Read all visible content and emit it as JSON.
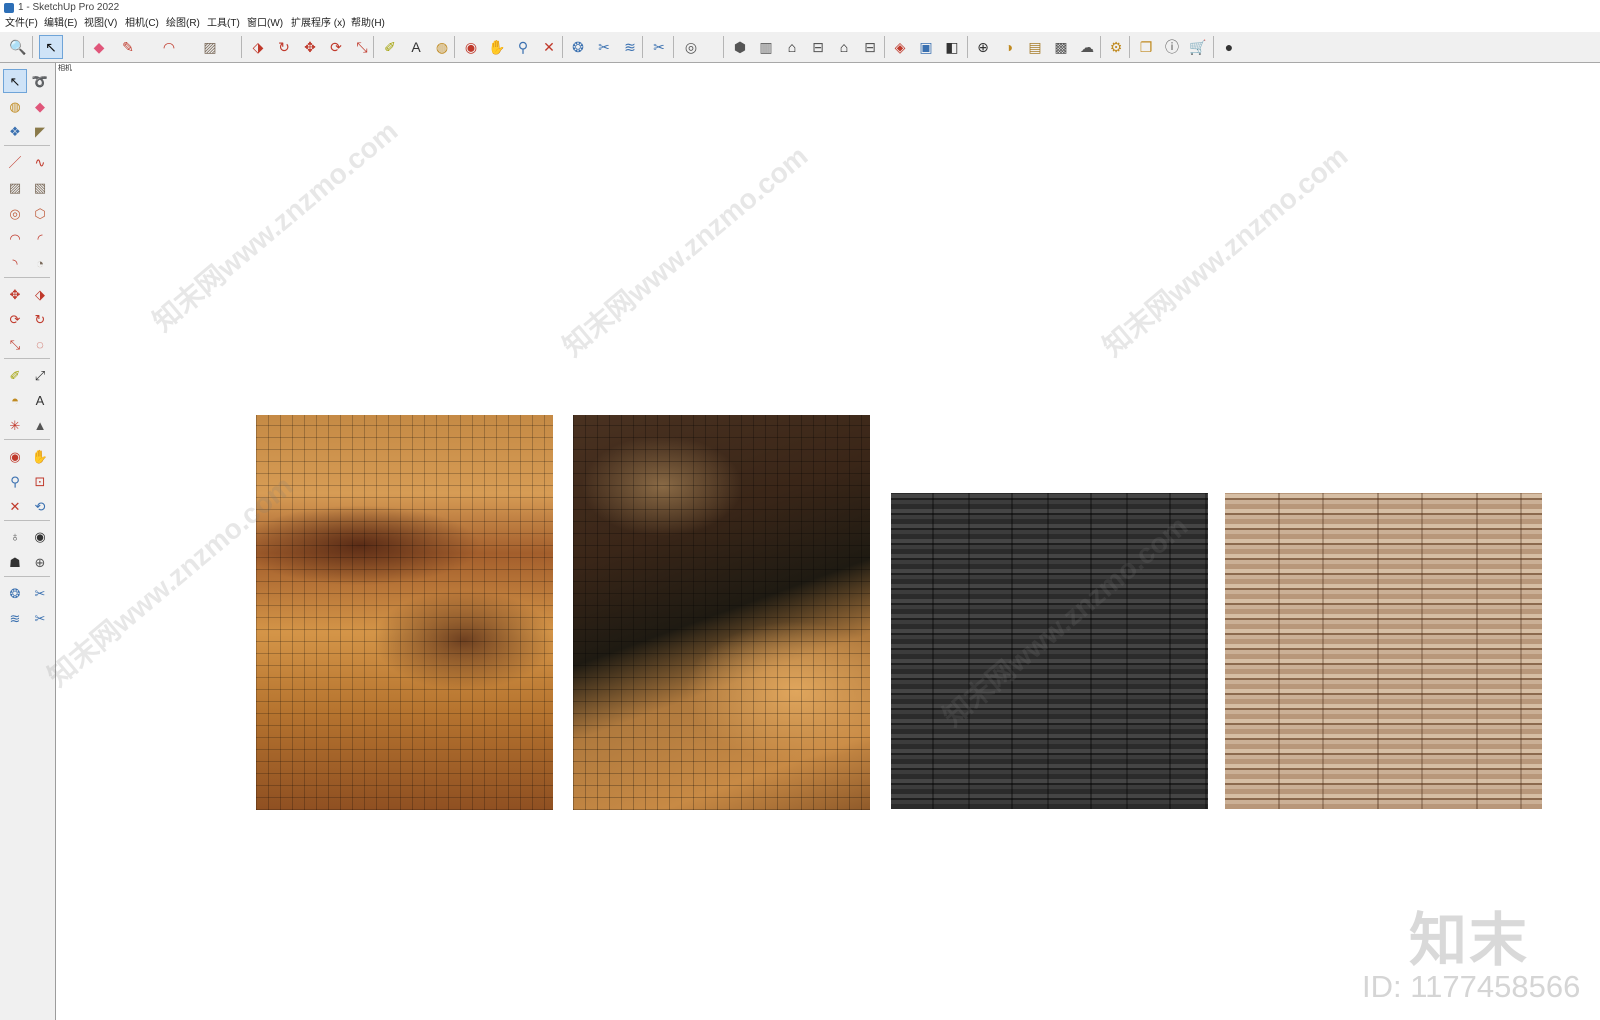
{
  "window": {
    "title": "1 - SketchUp Pro 2022"
  },
  "menu": {
    "items": [
      "文件(F)",
      "编辑(E)",
      "视图(V)",
      "相机(C)",
      "绘图(R)",
      "工具(T)",
      "窗口(W)",
      "扩展程序 (x)",
      "帮助(H)"
    ]
  },
  "toolbar": {
    "tools": [
      {
        "icon": "zoom-icon",
        "glyph": "🔍"
      },
      {
        "icon": "select-icon",
        "glyph": "↖"
      },
      {
        "icon": "eraser-icon",
        "glyph": "◆"
      },
      {
        "icon": "pencil-icon",
        "glyph": "✎"
      },
      {
        "icon": "arc-icon",
        "glyph": "◠"
      },
      {
        "icon": "rectangle-icon",
        "glyph": "▨"
      },
      {
        "icon": "push-pull-icon",
        "glyph": "⬗"
      },
      {
        "icon": "follow-me-icon",
        "glyph": "↻"
      },
      {
        "icon": "move-icon",
        "glyph": "✥"
      },
      {
        "icon": "rotate-icon",
        "glyph": "⟳"
      },
      {
        "icon": "scale-icon",
        "glyph": "⤡"
      },
      {
        "icon": "tape-measure-icon",
        "glyph": "✐"
      },
      {
        "icon": "text-icon",
        "glyph": "A"
      },
      {
        "icon": "paint-bucket-icon",
        "glyph": "◍"
      },
      {
        "icon": "orbit-icon",
        "glyph": "◉"
      },
      {
        "icon": "pan-icon",
        "glyph": "✋"
      },
      {
        "icon": "zoom-tool-icon",
        "glyph": "⚲"
      },
      {
        "icon": "zoom-extents-icon",
        "glyph": "✕"
      },
      {
        "icon": "warehouse-icon",
        "glyph": "❂"
      },
      {
        "icon": "extension-icon",
        "glyph": "✂"
      },
      {
        "icon": "layers-icon",
        "glyph": "≋"
      },
      {
        "icon": "extension-2-icon",
        "glyph": "✂"
      },
      {
        "icon": "user-icon",
        "glyph": "◎"
      },
      {
        "icon": "iso-view-icon",
        "glyph": "⬢"
      },
      {
        "icon": "top-view-icon",
        "glyph": "▥"
      },
      {
        "icon": "front-view-icon",
        "glyph": "⌂"
      },
      {
        "icon": "right-view-icon",
        "glyph": "⊟"
      },
      {
        "icon": "back-view-icon",
        "glyph": "⌂"
      },
      {
        "icon": "left-view-icon",
        "glyph": "⊟"
      },
      {
        "icon": "section-plane-icon",
        "glyph": "◈"
      },
      {
        "icon": "section-display-icon",
        "glyph": "▣"
      },
      {
        "icon": "section-cut-icon",
        "glyph": "◧"
      },
      {
        "icon": "add-location-icon",
        "glyph": "⊕"
      },
      {
        "icon": "shadows-icon",
        "glyph": "◑"
      },
      {
        "icon": "styles-icon",
        "glyph": "▤"
      },
      {
        "icon": "fog-icon",
        "glyph": "▩"
      },
      {
        "icon": "cloud-icon",
        "glyph": "☁"
      },
      {
        "icon": "extension-manager-icon",
        "glyph": "⚙"
      },
      {
        "icon": "components-icon",
        "glyph": "❐"
      },
      {
        "icon": "info-icon",
        "glyph": "ⓘ"
      },
      {
        "icon": "cart-icon",
        "glyph": "🛒"
      },
      {
        "icon": "account-icon",
        "glyph": "●"
      }
    ]
  },
  "left_toolbar": {
    "tools": [
      {
        "icon": "select-icon",
        "glyph": "↖"
      },
      {
        "icon": "lasso-icon",
        "glyph": "➰"
      },
      {
        "icon": "paint-bucket-icon",
        "glyph": "◍"
      },
      {
        "icon": "eraser-icon",
        "glyph": "◆"
      },
      {
        "icon": "component-icon",
        "glyph": "❖"
      },
      {
        "icon": "tag-icon",
        "glyph": "◤"
      },
      {
        "icon": "line-icon",
        "glyph": "／"
      },
      {
        "icon": "freehand-icon",
        "glyph": "∿"
      },
      {
        "icon": "rectangle-icon",
        "glyph": "▨"
      },
      {
        "icon": "rotated-rectangle-icon",
        "glyph": "▧"
      },
      {
        "icon": "circle-icon",
        "glyph": "◎"
      },
      {
        "icon": "polygon-icon",
        "glyph": "⬡"
      },
      {
        "icon": "arc-icon",
        "glyph": "◠"
      },
      {
        "icon": "arc-2-icon",
        "glyph": "◜"
      },
      {
        "icon": "arc-3-icon",
        "glyph": "◝"
      },
      {
        "icon": "pie-icon",
        "glyph": "◔"
      },
      {
        "icon": "move-icon",
        "glyph": "✥"
      },
      {
        "icon": "push-pull-icon",
        "glyph": "⬗"
      },
      {
        "icon": "rotate-icon",
        "glyph": "⟳"
      },
      {
        "icon": "follow-me-icon",
        "glyph": "↻"
      },
      {
        "icon": "scale-icon",
        "glyph": "⤡"
      },
      {
        "icon": "offset-icon",
        "glyph": "◌"
      },
      {
        "icon": "tape-measure-icon",
        "glyph": "✐"
      },
      {
        "icon": "dimension-icon",
        "glyph": "⤢"
      },
      {
        "icon": "protractor-icon",
        "glyph": "◓"
      },
      {
        "icon": "text-icon",
        "glyph": "A"
      },
      {
        "icon": "axes-icon",
        "glyph": "✳"
      },
      {
        "icon": "3d-text-icon",
        "glyph": "▲"
      },
      {
        "icon": "orbit-icon",
        "glyph": "◉"
      },
      {
        "icon": "pan-icon",
        "glyph": "✋"
      },
      {
        "icon": "zoom-icon",
        "glyph": "⚲"
      },
      {
        "icon": "zoom-window-icon",
        "glyph": "⊡"
      },
      {
        "icon": "zoom-extents-icon",
        "glyph": "✕"
      },
      {
        "icon": "previous-view-icon",
        "glyph": "⟲"
      },
      {
        "icon": "position-camera-icon",
        "glyph": "♁"
      },
      {
        "icon": "look-around-icon",
        "glyph": "◉"
      },
      {
        "icon": "walk-icon",
        "glyph": "☗"
      },
      {
        "icon": "section-plane-icon",
        "glyph": "⊕"
      },
      {
        "icon": "warehouse-icon",
        "glyph": "❂"
      },
      {
        "icon": "extension-icon",
        "glyph": "✂"
      },
      {
        "icon": "layers-icon",
        "glyph": "≋"
      },
      {
        "icon": "extension-2-icon",
        "glyph": "✂"
      }
    ]
  },
  "viewport": {
    "scene_label": "相机",
    "watermarks": [
      "知末网www.znzmo.com",
      "知末网www.znzmo.com",
      "知末网www.znzmo.com",
      "知末网www.znzmo.com",
      "知末网www.znzmo.com"
    ],
    "brand": {
      "logo": "知末",
      "id_text": "ID: 1177458566"
    },
    "textures": [
      {
        "name": "wood-mosaic-light",
        "color": "#c58a45"
      },
      {
        "name": "wood-mosaic-dark",
        "color": "#3a2618"
      },
      {
        "name": "stacked-wood-black",
        "color": "#2f2f2f"
      },
      {
        "name": "stacked-wood-natural",
        "color": "#b8977a"
      }
    ]
  }
}
